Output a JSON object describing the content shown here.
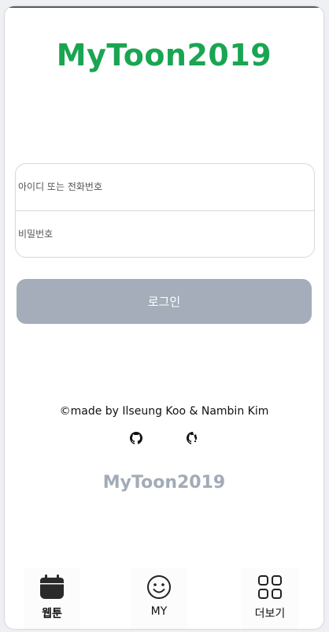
{
  "app": {
    "title": "MyToon2019"
  },
  "login": {
    "id_placeholder": "아이디 또는 전화번호",
    "password_placeholder": "비밀번호",
    "button_label": "로그인"
  },
  "footer": {
    "credit": "©made by Ilseung Koo & Nambin Kim",
    "logo": "MyToon2019",
    "links": [
      {
        "icon": "github-icon"
      },
      {
        "icon": "github-icon"
      }
    ]
  },
  "bottom_nav": {
    "items": [
      {
        "label": "웹툰",
        "icon": "calendar-icon",
        "active": true
      },
      {
        "label": "MY",
        "icon": "smiley-icon",
        "active": false
      },
      {
        "label": "더보기",
        "icon": "grid-icon",
        "active": false
      }
    ]
  },
  "colors": {
    "brand_green": "#1aa552",
    "button_gray": "#a4adb9",
    "footer_logo": "#a2abb7"
  }
}
